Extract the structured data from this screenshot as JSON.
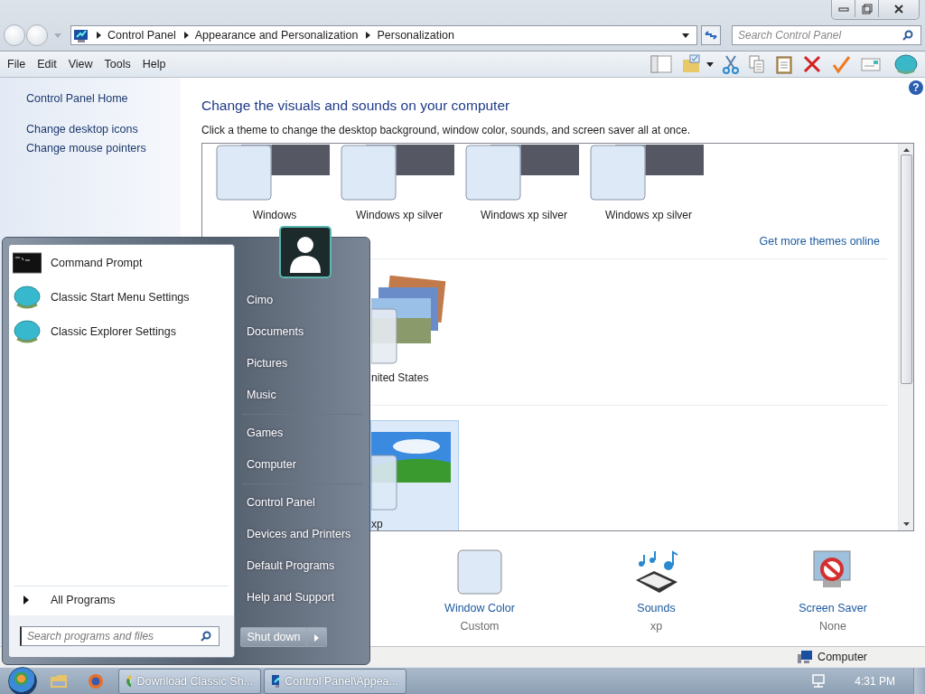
{
  "window": {
    "breadcrumb": [
      "Control Panel",
      "Appearance and Personalization",
      "Personalization"
    ],
    "search_placeholder": "Search Control Panel"
  },
  "menu": [
    "File",
    "Edit",
    "View",
    "Tools",
    "Help"
  ],
  "help_button": "?",
  "sidebar": {
    "links": [
      "Control Panel Home",
      "Change desktop icons",
      "Change mouse pointers"
    ]
  },
  "content": {
    "heading": "Change the visuals and sounds on your computer",
    "description": "Click a theme to change the desktop background, window color, sounds, and screen saver all at once.",
    "theme_groups": [
      {
        "more_link": "Get more themes online",
        "themes": [
          {
            "name": "Windows",
            "kind": "silver",
            "selected": false
          },
          {
            "name": "Windows xp silver",
            "kind": "silver",
            "selected": false
          },
          {
            "name": "Windows xp silver",
            "kind": "silver",
            "selected": false
          },
          {
            "name": "Windows xp silver",
            "kind": "silver",
            "selected": false
          }
        ]
      },
      {
        "themes": [
          {
            "name": "nited States",
            "kind": "landscape",
            "selected": false
          }
        ]
      },
      {
        "themes": [
          {
            "name": "xp",
            "kind": "bliss",
            "selected": true
          }
        ]
      }
    ],
    "settings": [
      {
        "kind": "window-color",
        "label": "Window Color",
        "value": "Custom"
      },
      {
        "kind": "sounds",
        "label": "Sounds",
        "value": "xp"
      },
      {
        "kind": "screen-saver",
        "label": "Screen Saver",
        "value": "None"
      }
    ]
  },
  "status_bar": {
    "location": "Computer"
  },
  "start_menu": {
    "programs": [
      {
        "label": "Command Prompt",
        "kind": "console"
      },
      {
        "label": "Classic Start Menu Settings",
        "kind": "shell"
      },
      {
        "label": "Classic Explorer Settings",
        "kind": "shell"
      }
    ],
    "all_programs": "All Programs",
    "search_placeholder": "Search programs and files",
    "places": [
      [
        "Cimo",
        "Documents",
        "Pictures",
        "Music"
      ],
      [
        "Games",
        "Computer"
      ],
      [
        "Control Panel",
        "Devices and Printers",
        "Default Programs",
        "Help and Support"
      ]
    ],
    "shutdown": "Shut down"
  },
  "taskbar": {
    "tasks": [
      {
        "label": "Download Classic Sh...",
        "kind": "browser"
      },
      {
        "label": "Control Panel\\Appea...",
        "kind": "control-panel"
      }
    ],
    "time": "4:31 PM"
  }
}
